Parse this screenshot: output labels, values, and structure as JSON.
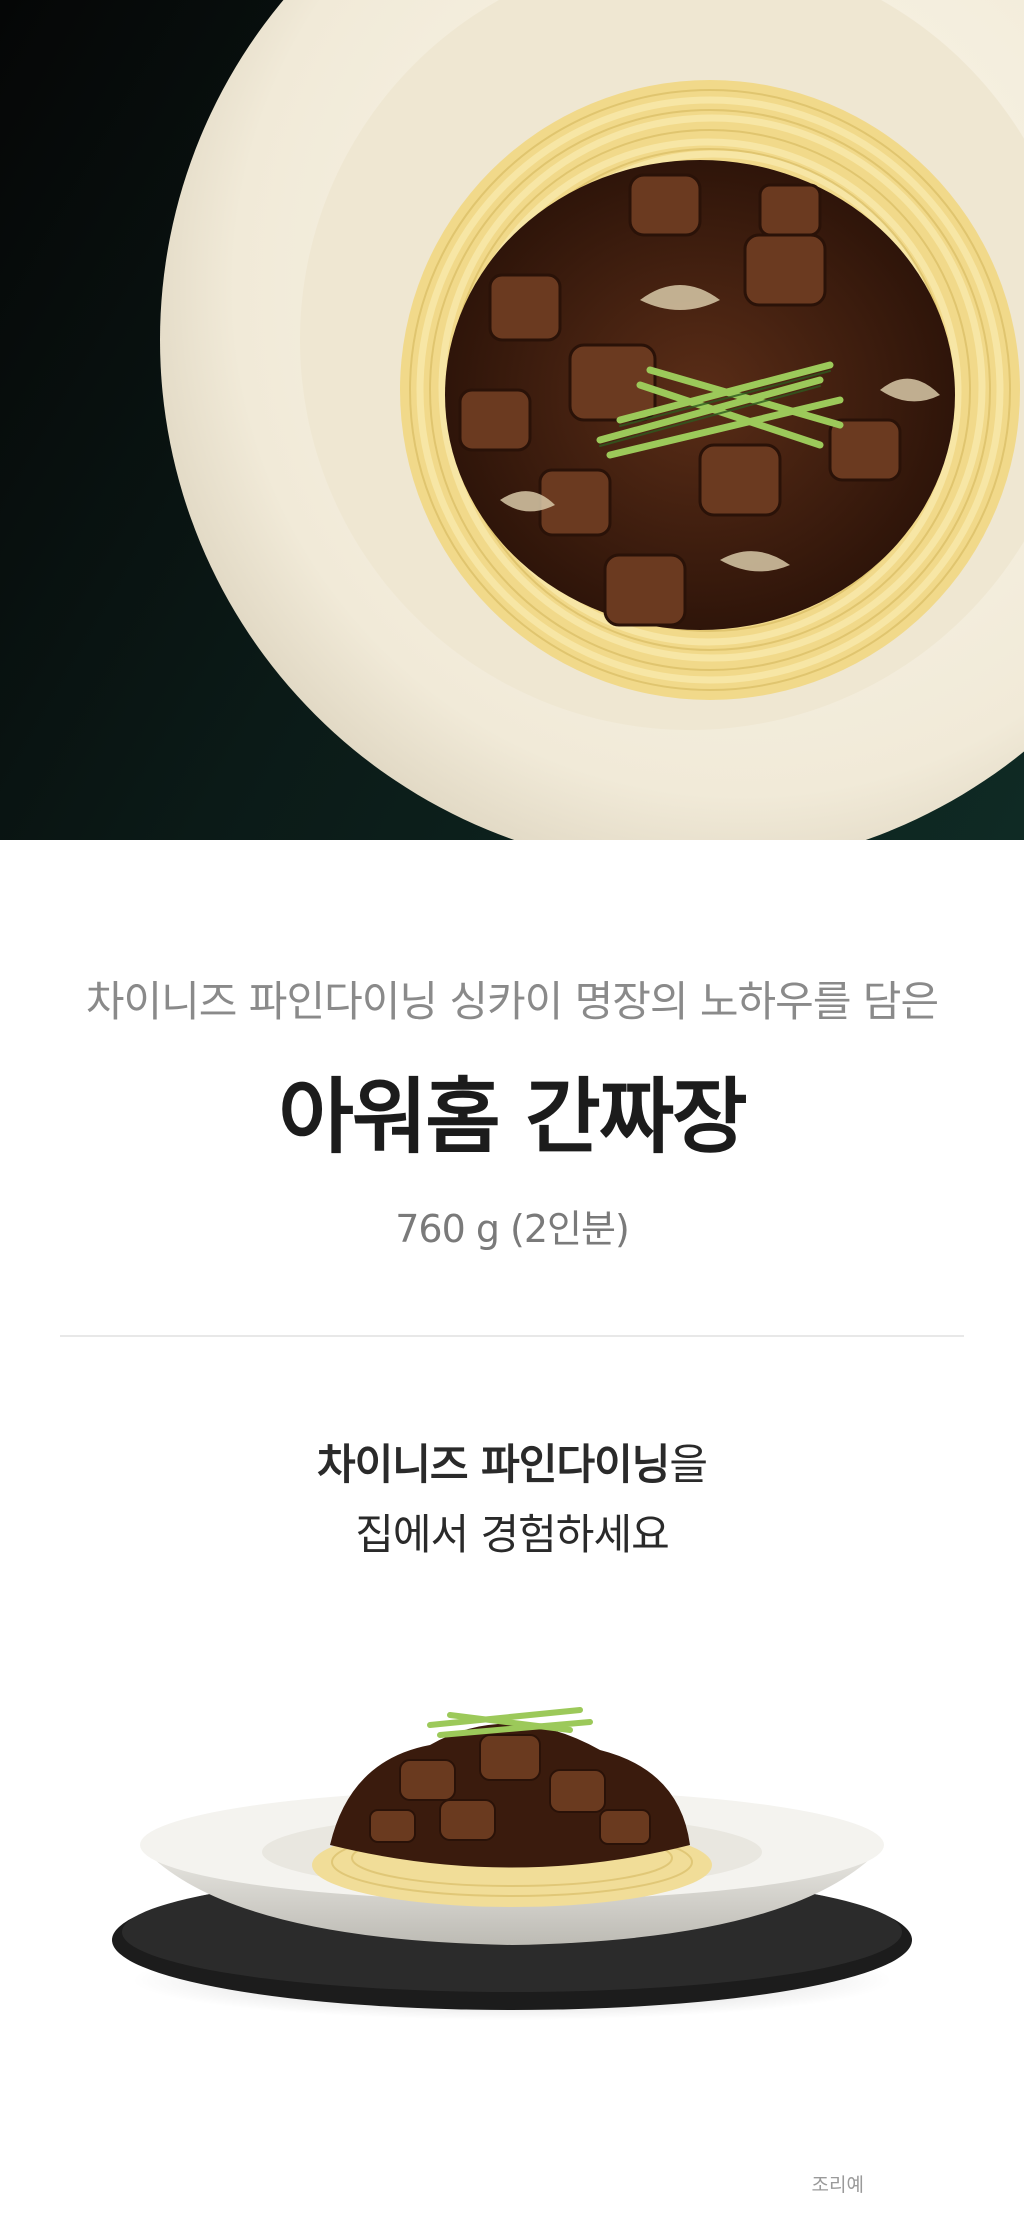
{
  "hero": {
    "image": "jjajang-noodle-bowl-top-view"
  },
  "intro": {
    "kicker": "차이니즈 파인다이닝 싱카이 명장의 노하우를 담은",
    "title": "아워홈 간짜장",
    "weight": "760 g (2인분)"
  },
  "section": {
    "tagline_bold": "차이니즈 파인다이닝",
    "tagline_rest": "을",
    "tagline_line2": "집에서 경험하세요",
    "image": "jjajang-plated-side-view",
    "caption": "조리예"
  },
  "colors": {
    "hero_bg": "#0f2a24",
    "noodle": "#f3dd8f",
    "sauce": "#3a1d10"
  }
}
